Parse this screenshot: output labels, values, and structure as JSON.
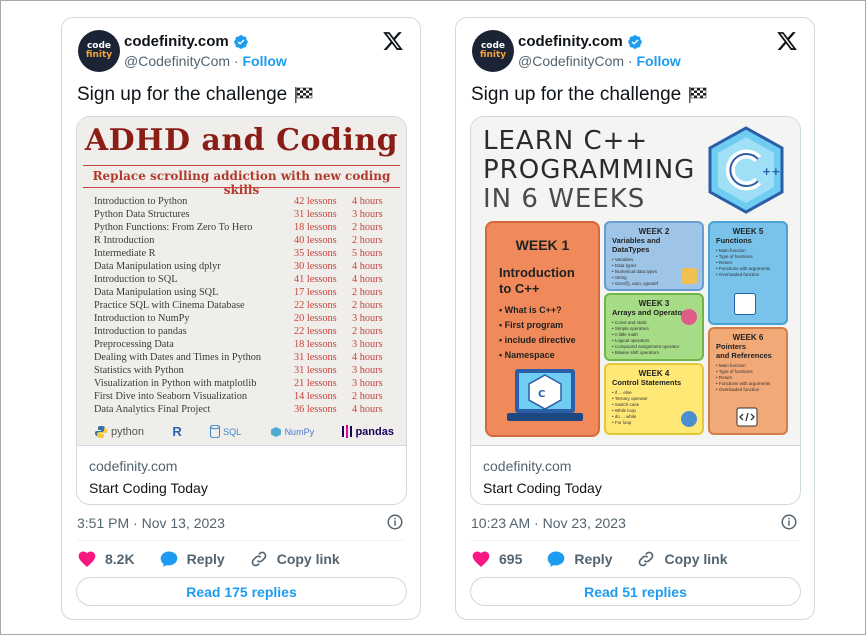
{
  "colors": {
    "accent": "#1d9bf0",
    "like": "#f91880",
    "text": "#0f1419",
    "muted": "#536471"
  },
  "tweets": [
    {
      "author": {
        "name": "codefinity.com",
        "handle": "@CodefinityCom",
        "follow_label": "Follow",
        "avatar_text_top": "code",
        "avatar_text_bottom": "finity"
      },
      "text": "Sign up for the challenge",
      "card": {
        "domain": "codefinity.com",
        "title": "Start Coding Today",
        "image": {
          "title": "ADHD and Coding",
          "subtitle": "Replace scrolling addiction with new coding skills",
          "courses": [
            {
              "name": "Introduction to Python",
              "lessons": "42 lessons",
              "hours": "4 hours"
            },
            {
              "name": "Python Data Structures",
              "lessons": "31 lessons",
              "hours": "3 hours"
            },
            {
              "name": "Python Functions: From Zero To Hero",
              "lessons": "18 lessons",
              "hours": "2 hours"
            },
            {
              "name": "R Introduction",
              "lessons": "40 lessons",
              "hours": "2 hours"
            },
            {
              "name": "Intermediate R",
              "lessons": "35 lessons",
              "hours": "5 hours"
            },
            {
              "name": "Data Manipulation using dplyr",
              "lessons": "30 lessons",
              "hours": "4 hours"
            },
            {
              "name": "Introduction to SQL",
              "lessons": "41 lessons",
              "hours": "4 hours"
            },
            {
              "name": "Data Manipulation using SQL",
              "lessons": "17 lessons",
              "hours": "2 hours"
            },
            {
              "name": "Practice SQL with Cinema Database",
              "lessons": "22 lessons",
              "hours": "2 hours"
            },
            {
              "name": "Introduction to NumPy",
              "lessons": "20 lessons",
              "hours": "3 hours"
            },
            {
              "name": "Introduction to pandas",
              "lessons": "22 lessons",
              "hours": "2 hours"
            },
            {
              "name": "Preprocessing Data",
              "lessons": "18 lessons",
              "hours": "3 hours"
            },
            {
              "name": "Dealing with Dates and Times in Python",
              "lessons": "31 lessons",
              "hours": "4 hours"
            },
            {
              "name": "Statistics with Python",
              "lessons": "31 lessons",
              "hours": "3 hours"
            },
            {
              "name": "Visualization in Python with matplotlib",
              "lessons": "21 lessons",
              "hours": "3 hours"
            },
            {
              "name": "First Dive into Seaborn Visualization",
              "lessons": "14 lessons",
              "hours": "2 hours"
            },
            {
              "name": "Data Analytics Final Project",
              "lessons": "36 lessons",
              "hours": "4 hours"
            }
          ],
          "logos": [
            "python",
            "R",
            "SQL",
            "NumPy",
            "pandas"
          ]
        }
      },
      "timestamp": "3:51 PM · Nov 13, 2023",
      "likes": "8.2K",
      "reply_label": "Reply",
      "copy_label": "Copy link",
      "read_replies": "Read 175 replies"
    },
    {
      "author": {
        "name": "codefinity.com",
        "handle": "@CodefinityCom",
        "follow_label": "Follow",
        "avatar_text_top": "code",
        "avatar_text_bottom": "finity"
      },
      "text": "Sign up for the challenge",
      "card": {
        "domain": "codefinity.com",
        "title": "Start Coding Today",
        "image": {
          "title_line1": "LEARN C++",
          "title_line2": "PROGRAMMING",
          "title_line3": "IN 6 WEEKS",
          "week1": {
            "label": "WEEK 1",
            "heading_line1": "Introduction",
            "heading_line2": "to C++",
            "bullets": [
              "• What is C++?",
              "• First program",
              "• include directive",
              "• Namespace"
            ]
          },
          "week2": {
            "label": "WEEK 2",
            "heading": "Variables and DataTypes",
            "bullets": [
              "• Variables",
              "• Data types",
              "• Numerical data types",
              "• String",
              "• sizeof(), auto, typedef"
            ]
          },
          "week3": {
            "label": "WEEK 3",
            "heading": "Arrays and Operators",
            "bullets": [
              "• Const and static",
              "• Simple operators",
              "• A little math",
              "• Logical operators",
              "• Compound assignment operator",
              "• Bitwise shift operators"
            ]
          },
          "week4": {
            "label": "WEEK 4",
            "heading": "Control Statements",
            "bullets": [
              "• if ... else",
              "• Ternary operator",
              "• Switch-case",
              "• While loop",
              "• do ... while",
              "• For loop"
            ]
          },
          "week5": {
            "label": "WEEK 5",
            "heading": "Functions",
            "bullets": [
              "• Main function",
              "• Type of functions",
              "• Return",
              "• Functions with arguments",
              "• Overloaded function"
            ]
          },
          "week6": {
            "label": "WEEK 6",
            "heading_line1": "Pointers",
            "heading_line2": "and References",
            "bullets": [
              "• Main function",
              "• Type of functions",
              "• Return",
              "• Functions with arguments",
              "• Overloaded function"
            ]
          }
        }
      },
      "timestamp": "10:23 AM · Nov 23, 2023",
      "likes": "695",
      "reply_label": "Reply",
      "copy_label": "Copy link",
      "read_replies": "Read 51 replies"
    }
  ]
}
